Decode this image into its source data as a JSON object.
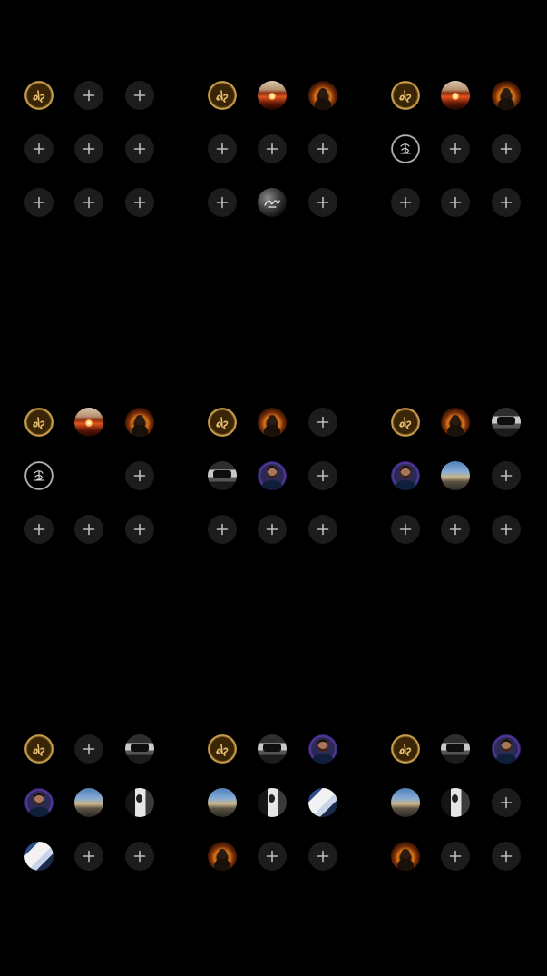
{
  "screen": {
    "background": "#000000",
    "add_slot_background": "#1c1c1c",
    "add_slot_icon_color": "#bdbdbd"
  },
  "add_label": "+",
  "panels": [
    {
      "slots": [
        "calligraphy-gold",
        "add",
        "add",
        "add",
        "add",
        "add",
        "add",
        "add",
        "add"
      ]
    },
    {
      "slots": [
        "calligraphy-gold",
        "sunset",
        "fire-portrait",
        "add",
        "add",
        "add",
        "add",
        "glitter-script",
        "add"
      ]
    },
    {
      "slots": [
        "calligraphy-gold",
        "sunset",
        "fire-portrait",
        "calligraphy-white",
        "add",
        "add",
        "add",
        "add",
        "add"
      ]
    },
    {
      "slots": [
        "calligraphy-gold",
        "sunset",
        "fire-portrait",
        "calligraphy-white",
        "empty",
        "add",
        "add",
        "add",
        "add"
      ]
    },
    {
      "slots": [
        "calligraphy-gold",
        "fire-portrait",
        "add",
        "car-bw",
        "man-purple",
        "add",
        "add",
        "add",
        "add"
      ]
    },
    {
      "slots": [
        "calligraphy-gold",
        "fire-portrait",
        "car-bw",
        "man-purple",
        "sky-blue",
        "add",
        "add",
        "add",
        "add"
      ]
    },
    {
      "slots": [
        "calligraphy-gold",
        "add",
        "car-bw",
        "man-purple",
        "sky-blue",
        "white-bw",
        "blue-white",
        "add",
        "add"
      ]
    },
    {
      "slots": [
        "calligraphy-gold",
        "car-bw",
        "man-purple",
        "sky-blue",
        "white-bw",
        "blue-white",
        "fire-portrait",
        "add",
        "add"
      ]
    },
    {
      "slots": [
        "calligraphy-gold",
        "car-bw",
        "man-purple",
        "sky-blue",
        "white-bw",
        "add",
        "fire-portrait",
        "add",
        "add"
      ]
    }
  ]
}
